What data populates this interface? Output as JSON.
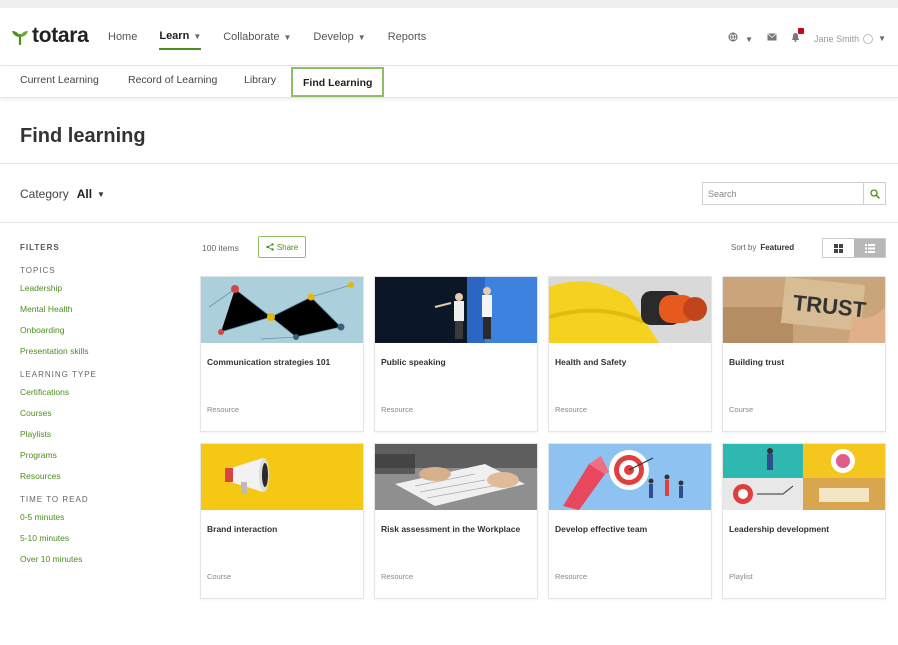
{
  "brand": {
    "name": "totara",
    "accent": "#4d8e1b"
  },
  "nav": {
    "items": [
      {
        "label": "Home",
        "dropdown": false,
        "active": false
      },
      {
        "label": "Learn",
        "dropdown": true,
        "active": true
      },
      {
        "label": "Collaborate",
        "dropdown": true,
        "active": false
      },
      {
        "label": "Develop",
        "dropdown": true,
        "active": false
      },
      {
        "label": "Reports",
        "dropdown": false,
        "active": false
      }
    ],
    "user_name": "Jane Smith"
  },
  "subnav": {
    "items": [
      {
        "label": "Current Learning"
      },
      {
        "label": "Record of Learning"
      },
      {
        "label": "Library"
      },
      {
        "label": "Find Learning",
        "active": true
      }
    ]
  },
  "page": {
    "title": "Find learning"
  },
  "category": {
    "label": "Category",
    "value": "All"
  },
  "search": {
    "placeholder": "Search"
  },
  "filters": {
    "title": "FILTERS",
    "groups": [
      {
        "title": "TOPICS",
        "items": [
          "Leadership",
          "Mental Health",
          "Onboarding",
          "Presentation skills"
        ]
      },
      {
        "title": "LEARNING TYPE",
        "items": [
          "Certifications",
          "Courses",
          "Playlists",
          "Programs",
          "Resources"
        ]
      },
      {
        "title": "TIME TO READ",
        "items": [
          "0-5 minutes",
          "5-10 minutes",
          "Over 10 minutes"
        ]
      }
    ]
  },
  "results": {
    "count": "100 items",
    "share_label": "Share",
    "sort_label": "Sort by",
    "sort_value": "Featured"
  },
  "cards": [
    {
      "title": "Communication strategies 101",
      "type": "Resource",
      "image": "network-pins"
    },
    {
      "title": "Public speaking",
      "type": "Resource",
      "image": "stage-speakers"
    },
    {
      "title": "Health and Safety",
      "type": "Resource",
      "image": "hard-hat"
    },
    {
      "title": "Building trust",
      "type": "Course",
      "image": "trust-blocks"
    },
    {
      "title": "Brand interaction",
      "type": "Course",
      "image": "megaphone"
    },
    {
      "title": "Risk assessment in the Workplace",
      "type": "Resource",
      "image": "desk-hands"
    },
    {
      "title": "Develop effective team",
      "type": "Resource",
      "image": "target-team"
    },
    {
      "title": "Leadership development",
      "type": "Playlist",
      "image": "leadership-collage"
    }
  ]
}
